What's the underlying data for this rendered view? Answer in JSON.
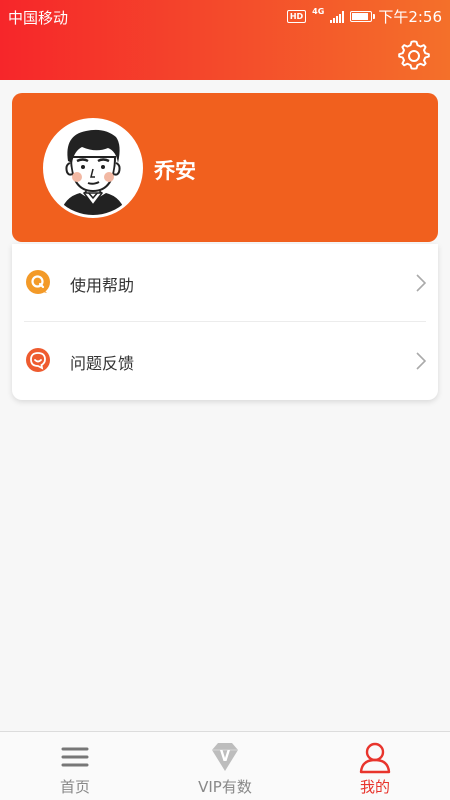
{
  "status_bar": {
    "carrier": "中国移动",
    "hd": "HD",
    "network": "4G",
    "time": "下午2:56"
  },
  "header": {
    "settings_icon": "gear-icon"
  },
  "profile": {
    "username": "乔安",
    "avatar_icon": "user-cartoon-avatar"
  },
  "menu": {
    "items": [
      {
        "label": "使用帮助",
        "icon": "help-q-icon",
        "icon_color": "#f39a28"
      },
      {
        "label": "问题反馈",
        "icon": "feedback-smile-icon",
        "icon_color": "#ee5b2f"
      }
    ]
  },
  "tabbar": {
    "tabs": [
      {
        "label": "首页",
        "icon": "menu-lines-icon",
        "active": false
      },
      {
        "label": "VIP有数",
        "icon": "vip-diamond-icon",
        "active": false
      },
      {
        "label": "我的",
        "icon": "person-icon",
        "active": true
      }
    ]
  },
  "colors": {
    "accent": "#f1601e",
    "active_tab": "#e8342c",
    "inactive_tab": "#888888"
  }
}
